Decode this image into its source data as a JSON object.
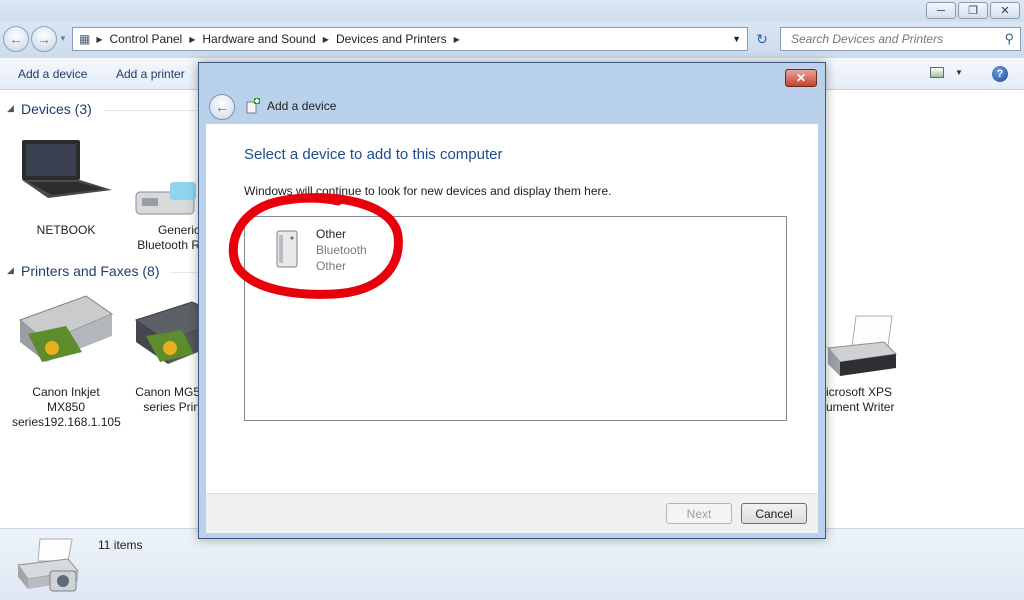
{
  "window": {
    "minimize_icon": "minimize-icon",
    "maximize_icon": "restore-icon",
    "close_icon": "close-icon"
  },
  "nav": {
    "breadcrumbs": [
      "Control Panel",
      "Hardware and Sound",
      "Devices and Printers"
    ],
    "search_placeholder": "Search Devices and Printers"
  },
  "toolbar": {
    "add_device": "Add a device",
    "add_printer": "Add a printer"
  },
  "groups": {
    "devices": {
      "title": "Devices (3)",
      "items": [
        {
          "label": "NETBOOK"
        },
        {
          "label": "Generic Bluetooth R"
        }
      ]
    },
    "printers": {
      "title": "Printers and Faxes (8)",
      "items": [
        {
          "label": "Canon Inkjet MX850 series192.168.1.105"
        },
        {
          "label": "Canon MG5 series Prin"
        },
        {
          "label": "icrosoft XPS ument Writer"
        }
      ]
    }
  },
  "status": {
    "count": "11 items"
  },
  "dialog": {
    "title": "Add a device",
    "heading": "Select a device to add to this computer",
    "subtext": "Windows will continue to look for new devices and display them here.",
    "device": {
      "name": "Other",
      "line1": "Bluetooth",
      "line2": "Other"
    },
    "next_label": "Next",
    "cancel_label": "Cancel",
    "annotation_color": "#e8000b"
  }
}
